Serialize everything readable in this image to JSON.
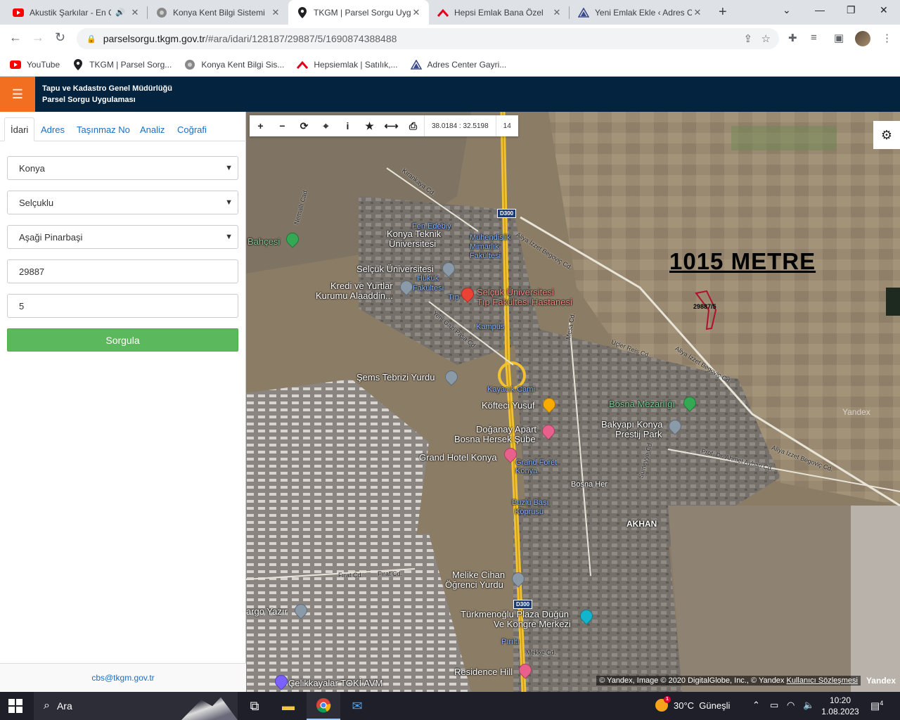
{
  "browser": {
    "tabs": [
      {
        "label": "Akustik Şarkılar - En Ç",
        "icon": "youtube-icon",
        "color": "#ff0000",
        "audio": true
      },
      {
        "label": "Konya Kent Bilgi Sistemi",
        "icon": "emblem-icon",
        "color": "#777777"
      },
      {
        "label": "TKGM | Parsel Sorgu Uyg",
        "icon": "location-pin-icon",
        "color": "#202124",
        "active": true
      },
      {
        "label": "Hepsi Emlak Bana Özel",
        "icon": "hepsiemlak-icon",
        "color": "#e2001a"
      },
      {
        "label": "Yeni Emlak Ekle ‹ Adres C",
        "icon": "adres-center-icon",
        "color": "#3b4a8c"
      }
    ],
    "close_glyph": "✕",
    "new_tab_glyph": "+",
    "window_controls": [
      "⌄",
      "—",
      "❐",
      "✕"
    ],
    "address": {
      "host": "parselsorgu.tkgm.gov.tr",
      "path": "/#ara/idari/128187/29887/5/1690874388488"
    },
    "bookmarks": [
      {
        "label": "YouTube",
        "icon": "youtube-icon",
        "color": "#ff0000"
      },
      {
        "label": "TKGM | Parsel Sorg...",
        "icon": "location-pin-icon",
        "color": "#202124"
      },
      {
        "label": "Konya Kent Bilgi Sis...",
        "icon": "emblem-icon",
        "color": "#777777"
      },
      {
        "label": "Hepsiemlak | Satılık,...",
        "icon": "hepsiemlak-icon",
        "color": "#e2001a"
      },
      {
        "label": "Adres Center Gayri...",
        "icon": "adres-center-icon",
        "color": "#3b4a8c"
      }
    ]
  },
  "app": {
    "title_line1": "Tapu ve Kadastro Genel Müdürlüğü",
    "title_line2": "Parsel Sorgu Uygulaması",
    "accent": "#f26f21",
    "header_bg": "#04233f"
  },
  "panel": {
    "tabs": [
      "İdari",
      "Adres",
      "Taşınmaz No",
      "Analiz",
      "Coğrafi"
    ],
    "active_tab": "İdari",
    "province": "Konya",
    "district": "Selçuklu",
    "neighborhood": "Aşaği Pinarbaşi",
    "block": "29887",
    "parcel": "5",
    "submit_label": "Sorgula",
    "submit_color": "#5cb85c",
    "footer_email": "cbs@tkgm.gov.tr"
  },
  "map": {
    "coords": "38.0184 : 32.5198",
    "zoom": "14",
    "annotation": "1015 METRE",
    "parcel_label": "29887/5",
    "highway_shield": "D300",
    "attribution": "© Yandex, Image © 2020 DigitalGlobe, Inc., © Yandex",
    "attribution_link": "Kullanıcı Sözleşmesi",
    "yandex": "Yandex",
    "labels": {
      "bahcesi": "Bahçesi",
      "ktu1": "Konya Teknik",
      "ktu2": "Üniversitesi",
      "fen": "Fen Edebiy",
      "muh1": "Mühendislik",
      "muh2": "Mimarlık",
      "muh3": "Fakültesi",
      "selcuk_uni": "Selçuk Üniversitesi",
      "hukuk1": "Hukuk",
      "hukuk2": "Fakültesi",
      "kredi1": "Kredi ve Yurtlar",
      "kredi2": "Kurumu Alaaddin...",
      "hosp1": "Selçuk Üniversitesi",
      "hosp2": "Tıp Fakültesi Hastanesi",
      "tip": "Tıp",
      "kampus": "Kampüs",
      "sems": "Şems Tebrizi Yurdu",
      "kayacik": "Kayacık Cami",
      "kofteci": "Köfteci Yusuf",
      "bosna_mez": "Bosna Mezarlığı",
      "doganay1": "Doğanay Apart",
      "doganay2": "Bosna Hersek Şube",
      "bakyapi1": "Bakyapı Konya",
      "bakyapi2": "Prestij Park",
      "grand": "Grand Hotel Konya",
      "grand2": "Grand Foret",
      "grand3": "Konya",
      "bosna_her": "Bosna Her",
      "buzlu1": "Buzlu Başı",
      "buzlu2": "Köprüsü",
      "akhan": "AKHAN",
      "melike1": "Melike Cihan",
      "melike2": "Öğrenci Yurdu",
      "cargo": "argo Yazır",
      "turkmen1": "Türkmenoğlu Plaza Düğün",
      "turkmen2": "Ve Kongre Merkezi",
      "pirilti": "Pırıltı",
      "residence": "Residence Hill",
      "celik": "Çelikkayalar TOKİ AVM",
      "mekke": "Mekke Cd.",
      "road_kirankaya": "Kırankaya Cd.",
      "road_aliya": "Aliya İzzet Begoviç Cd.",
      "road_aliya2": "Aliya İzzet Begoviç Cd.",
      "road_aliya3": "Aliya İzzet Begoviç Cd.",
      "road_ahmet": "Prof. Dr. Ahmet Ayhan Cd.",
      "road_firat": "Fırat Cd.",
      "road_firat2": "Fırat Cd.",
      "road_ucler": "Üçler Reis Cd.",
      "road_nemalli": "Nemallı Cad.",
      "road_yeni": "Yeni Gazi Pasa Cd.",
      "road_mesa": "Mesa Cd.",
      "road_sumaya": "Sümeyye Cd."
    }
  },
  "taskbar": {
    "search_placeholder": "Ara",
    "temperature": "30°C",
    "weather": "Güneşli",
    "weather_badge": "1",
    "time": "10:20",
    "date": "1.08.2023",
    "notifications": "4"
  }
}
